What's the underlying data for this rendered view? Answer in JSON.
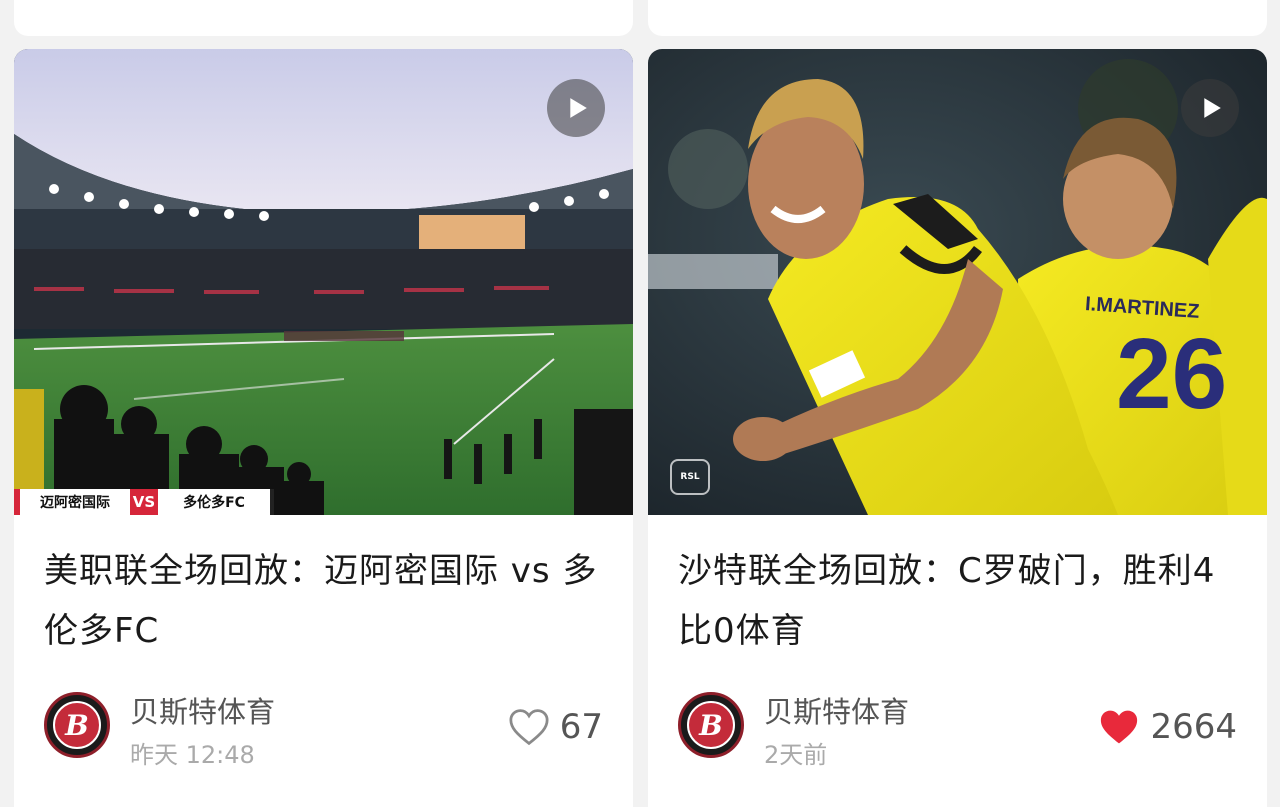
{
  "posts": [
    {
      "title": "美职联全场回放：迈阿密国际 vs 多伦多FC",
      "scoreboard": {
        "home": "迈阿密国际",
        "vs": "VS",
        "away": "多伦多FC"
      },
      "author": "贝斯特体育",
      "time": "昨天 12:48",
      "likes": "67",
      "liked": false,
      "avatar_letter": "B"
    },
    {
      "title": "沙特联全场回放：C罗破门，胜利4比0体育",
      "jersey_name": "I.MARTINEZ",
      "jersey_number": "26",
      "league_logo": "RSL",
      "author": "贝斯特体育",
      "time": "2天前",
      "likes": "2664",
      "liked": true,
      "avatar_letter": "B"
    }
  ],
  "icons": {
    "play": "play-icon",
    "heart_outline": "heart-outline-icon",
    "heart_filled": "heart-filled-icon"
  },
  "colors": {
    "like_active": "#e8293b",
    "like_inactive": "#8a8a8a",
    "jersey_yellow": "#f2e61a",
    "pitch_green": "#3e8a3a",
    "scoreboard_red": "#d6263a"
  }
}
